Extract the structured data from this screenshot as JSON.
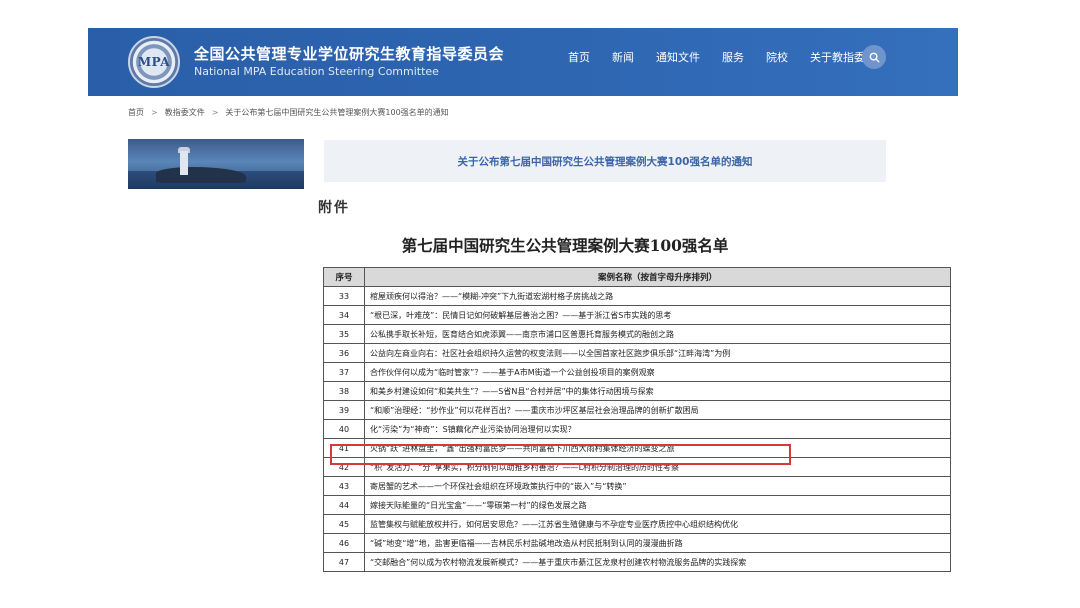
{
  "header": {
    "logo_text": "MPA",
    "org_name_cn": "全国公共管理专业学位研究生教育指导委员会",
    "org_name_en": "National MPA Education Steering Committee",
    "nav": [
      "首页",
      "新闻",
      "通知文件",
      "服务",
      "院校",
      "关于教指委"
    ],
    "search_icon": "search-icon"
  },
  "breadcrumb": [
    "首页",
    "教指委文件",
    "关于公布第七届中国研究生公共管理案例大赛100强名单的通知"
  ],
  "page_title": "关于公布第七届中国研究生公共管理案例大赛100强名单的通知",
  "attachment_label": "附件",
  "list_title": "第七届中国研究生公共管理案例大赛100强名单",
  "table": {
    "headers": [
      "序号",
      "案例名称（按首字母升序排列）"
    ],
    "rows": [
      {
        "no": "33",
        "name": "棺屋顽疾何以得治？——“模糊-冲突”下九街道宏湖村格子房挑战之路"
      },
      {
        "no": "34",
        "name": "“根已深，叶难茂”：民情日记如何破解基层善治之困？——基于浙江省S市实践的思考"
      },
      {
        "no": "35",
        "name": "公私携手取长补短，医育结合如虎添翼——南京市浦口区普惠托育服务模式的融创之路"
      },
      {
        "no": "36",
        "name": "公益向左商业向右：社区社会组织持久运营的权变法则——以全国首家社区跑步俱乐部“江畔海湾”为例"
      },
      {
        "no": "37",
        "name": "合作伙伴何以成为“临时管家”？——基于A市M街道一个公益创投项目的案例观察"
      },
      {
        "no": "38",
        "name": "和美乡村建设如何“和美共生”？——S省N县“合村并居”中的集体行动困境与探索"
      },
      {
        "no": "39",
        "name": "“和顺”治理经：“抄作业”何以花样百出？——重庆市沙坪区基层社会治理品牌的创新扩散困局"
      },
      {
        "no": "40",
        "name": "化“污染”为“神奇”：S镇藕化产业污染协同治理何以实现？"
      },
      {
        "no": "41",
        "name": "火锅“跃”进林盘里，“鑫”出强村富民梦——共同富裕下川西大雨村集体经济的蝶变之旅"
      },
      {
        "no": "42",
        "name": "“积”发活力、“分”享果实，积分制何以助推乡村善治？——L村积分制治理的历时性考察"
      },
      {
        "no": "43",
        "name": "寄居蟹的艺术——一个环保社会组织在环境政策执行中的“嵌入”与“转换”"
      },
      {
        "no": "44",
        "name": "嫁接天际能量的“日光宝盒”——“零碳第一村”的绿色发展之路"
      },
      {
        "no": "45",
        "name": "监管集权与赋能放权并行，如何居安思危？——江苏省生殖健康与不孕症专业医疗质控中心组织结构优化"
      },
      {
        "no": "46",
        "name": "“碱”地变“增”地，盐害更临福——吉林民乐村盐碱地改造从村民抵制到认同的漫漫曲折路"
      },
      {
        "no": "47",
        "name": "“交邮融合”何以成为农村物流发展新模式？——基于重庆市綦江区龙泉村创建农村物流服务品牌的实践探索"
      }
    ],
    "highlighted_row_no": "41"
  }
}
